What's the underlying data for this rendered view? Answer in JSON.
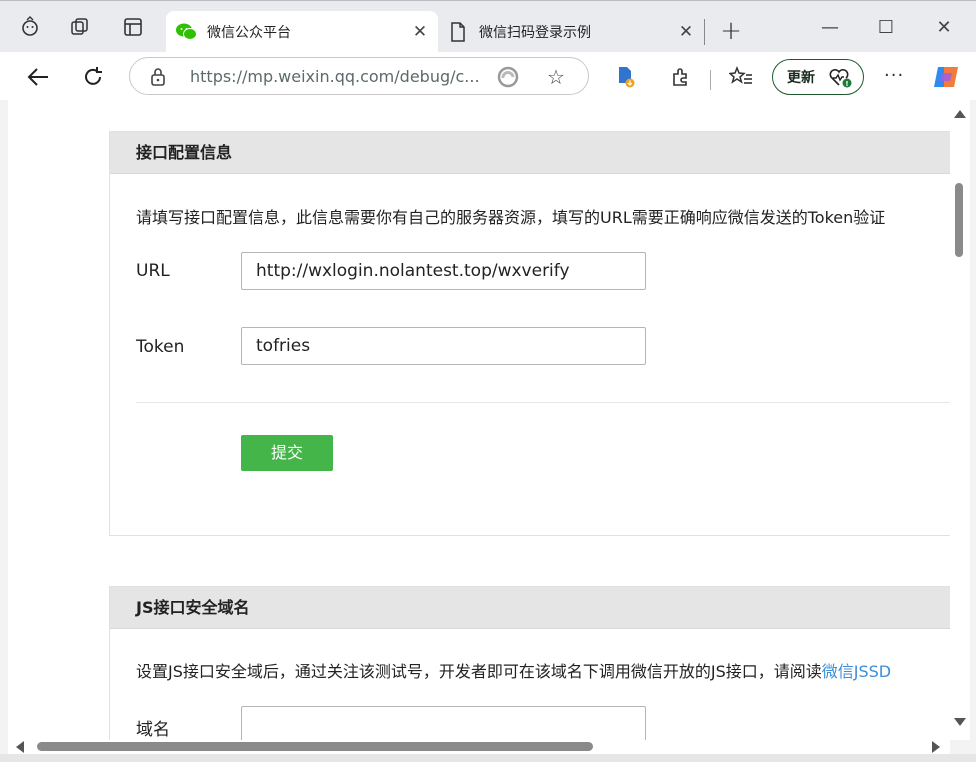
{
  "browser": {
    "tabs": [
      {
        "title": "微信公众平台",
        "icon": "wechat-icon",
        "active": true
      },
      {
        "title": "微信扫码登录示例",
        "icon": "document-icon",
        "active": false
      }
    ],
    "close_glyph": "✕",
    "new_tab_glyph": "+",
    "window_controls": {
      "minimize": "—",
      "maximize": "☐",
      "close": "✕"
    },
    "address": {
      "url": "https://mp.weixin.qq.com/debug/c..."
    },
    "update_button": "更新",
    "more_glyph": "···"
  },
  "page": {
    "api_config": {
      "title": "接口配置信息",
      "description": "请填写接口配置信息，此信息需要你有自己的服务器资源，填写的URL需要正确响应微信发送的Token验证",
      "url_label": "URL",
      "url_value": "http://wxlogin.nolantest.top/wxverify",
      "token_label": "Token",
      "token_value": "tofries",
      "submit_label": "提交"
    },
    "js_domain": {
      "title": "JS接口安全域名",
      "description": "设置JS接口安全域后，通过关注该测试号，开发者即可在该域名下调用微信开放的JS接口，请阅读",
      "link_text": "微信JSSD",
      "domain_label": "域名",
      "domain_value": ""
    }
  },
  "colors": {
    "submit_green": "#44b549",
    "panel_header": "#e5e5e5",
    "link_blue": "#3b8fd9",
    "wechat_green": "#2dc100"
  }
}
